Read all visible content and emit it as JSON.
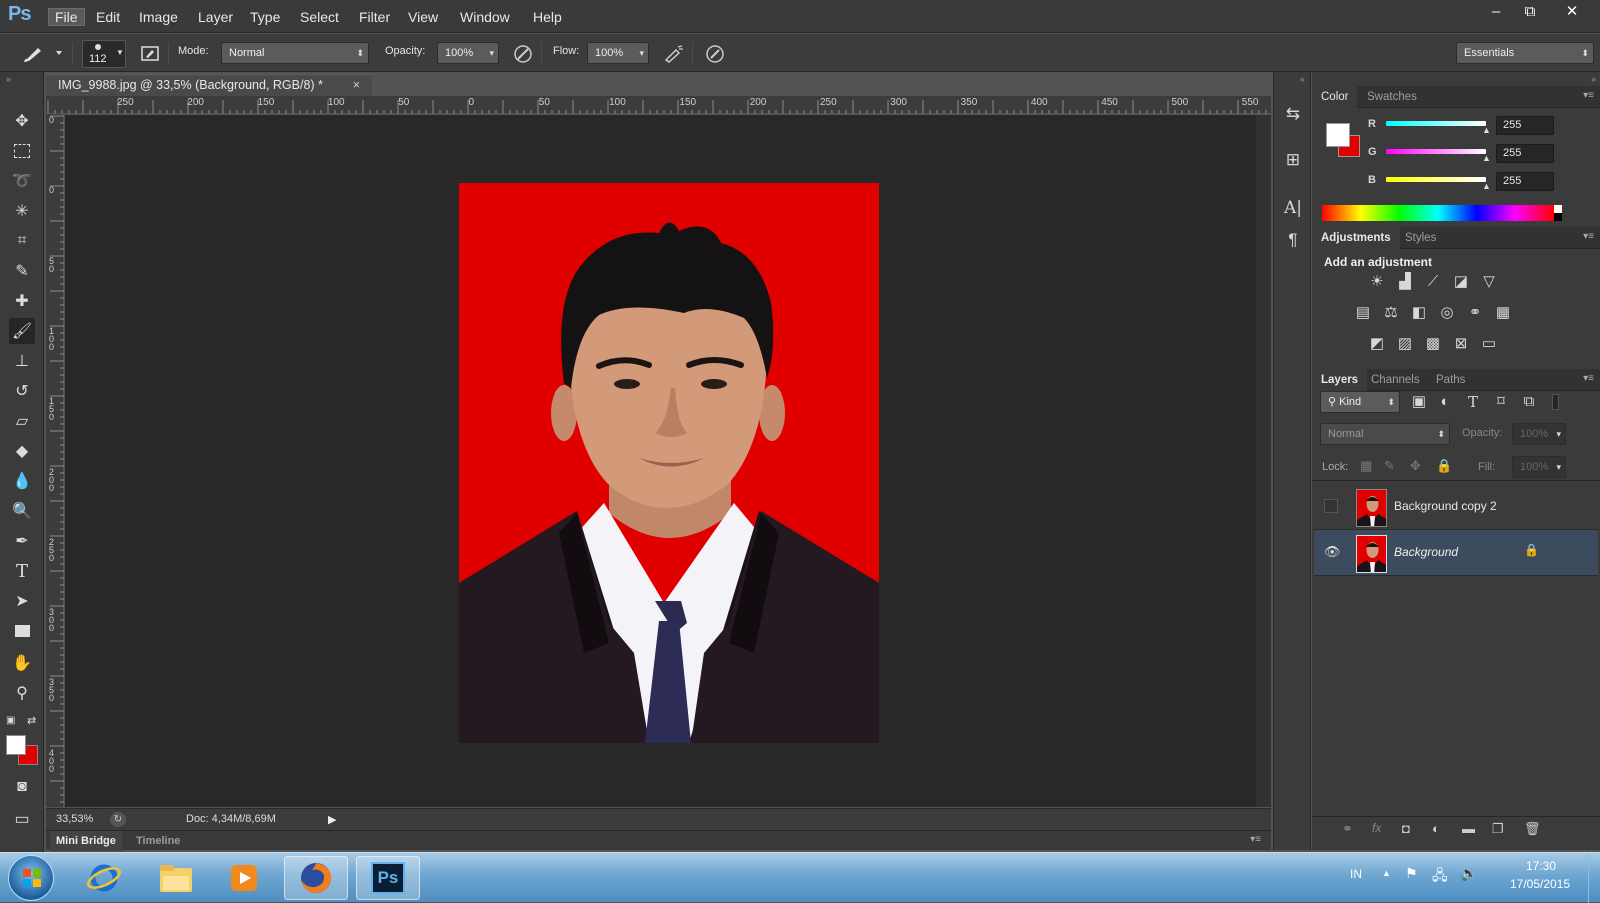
{
  "app": {
    "logo": "Ps"
  },
  "menu": [
    "File",
    "Edit",
    "Image",
    "Layer",
    "Type",
    "Select",
    "Filter",
    "View",
    "Window",
    "Help"
  ],
  "window_controls": {
    "minimize": "–",
    "restore": "⧉",
    "close": "✕"
  },
  "options": {
    "brush_size": "112",
    "mode_label": "Mode:",
    "mode_value": "Normal",
    "opacity_label": "Opacity:",
    "opacity_value": "100%",
    "flow_label": "Flow:",
    "flow_value": "100%",
    "workspace": "Essentials"
  },
  "document": {
    "tab_title": "IMG_9988.jpg @ 33,5% (Background, RGB/8) *",
    "close": "×",
    "zoom": "33,53%",
    "doc_info": "Doc: 4,34M/8,69M"
  },
  "ruler": {
    "h_ticks": [
      "250",
      "200",
      "150",
      "100",
      "50",
      "0",
      "50",
      "100",
      "150",
      "200",
      "250",
      "300",
      "350",
      "400",
      "450",
      "500",
      "550"
    ],
    "v_ticks": [
      "0",
      "0",
      "5 0",
      "1 0 0",
      "1 5 0",
      "2 0 0",
      "2 5 0",
      "3 0 0",
      "3 5 0",
      "4 0 0"
    ]
  },
  "bottom_tabs": {
    "mini_bridge": "Mini Bridge",
    "timeline": "Timeline"
  },
  "color_panel": {
    "tabs": [
      "Color",
      "Swatches"
    ],
    "channels": [
      {
        "label": "R",
        "value": "255"
      },
      {
        "label": "G",
        "value": "255"
      },
      {
        "label": "B",
        "value": "255"
      }
    ],
    "foreground": "#ffffff",
    "background": "#e00000"
  },
  "adjustments_panel": {
    "tabs": [
      "Adjustments",
      "Styles"
    ],
    "heading": "Add an adjustment"
  },
  "layers_panel": {
    "tabs": [
      "Layers",
      "Channels",
      "Paths"
    ],
    "filter_kind": "Kind",
    "blend_mode": "Normal",
    "opacity_label": "Opacity:",
    "opacity_value": "100%",
    "lock_label": "Lock:",
    "fill_label": "Fill:",
    "fill_value": "100%",
    "layers": [
      {
        "name": "Background copy 2",
        "visible": false,
        "selected": false,
        "locked": false
      },
      {
        "name": "Background",
        "visible": true,
        "selected": true,
        "locked": true
      }
    ]
  },
  "taskbar": {
    "language": "IN",
    "time": "17:30",
    "date": "17/05/2015",
    "ps_button": "Ps"
  }
}
